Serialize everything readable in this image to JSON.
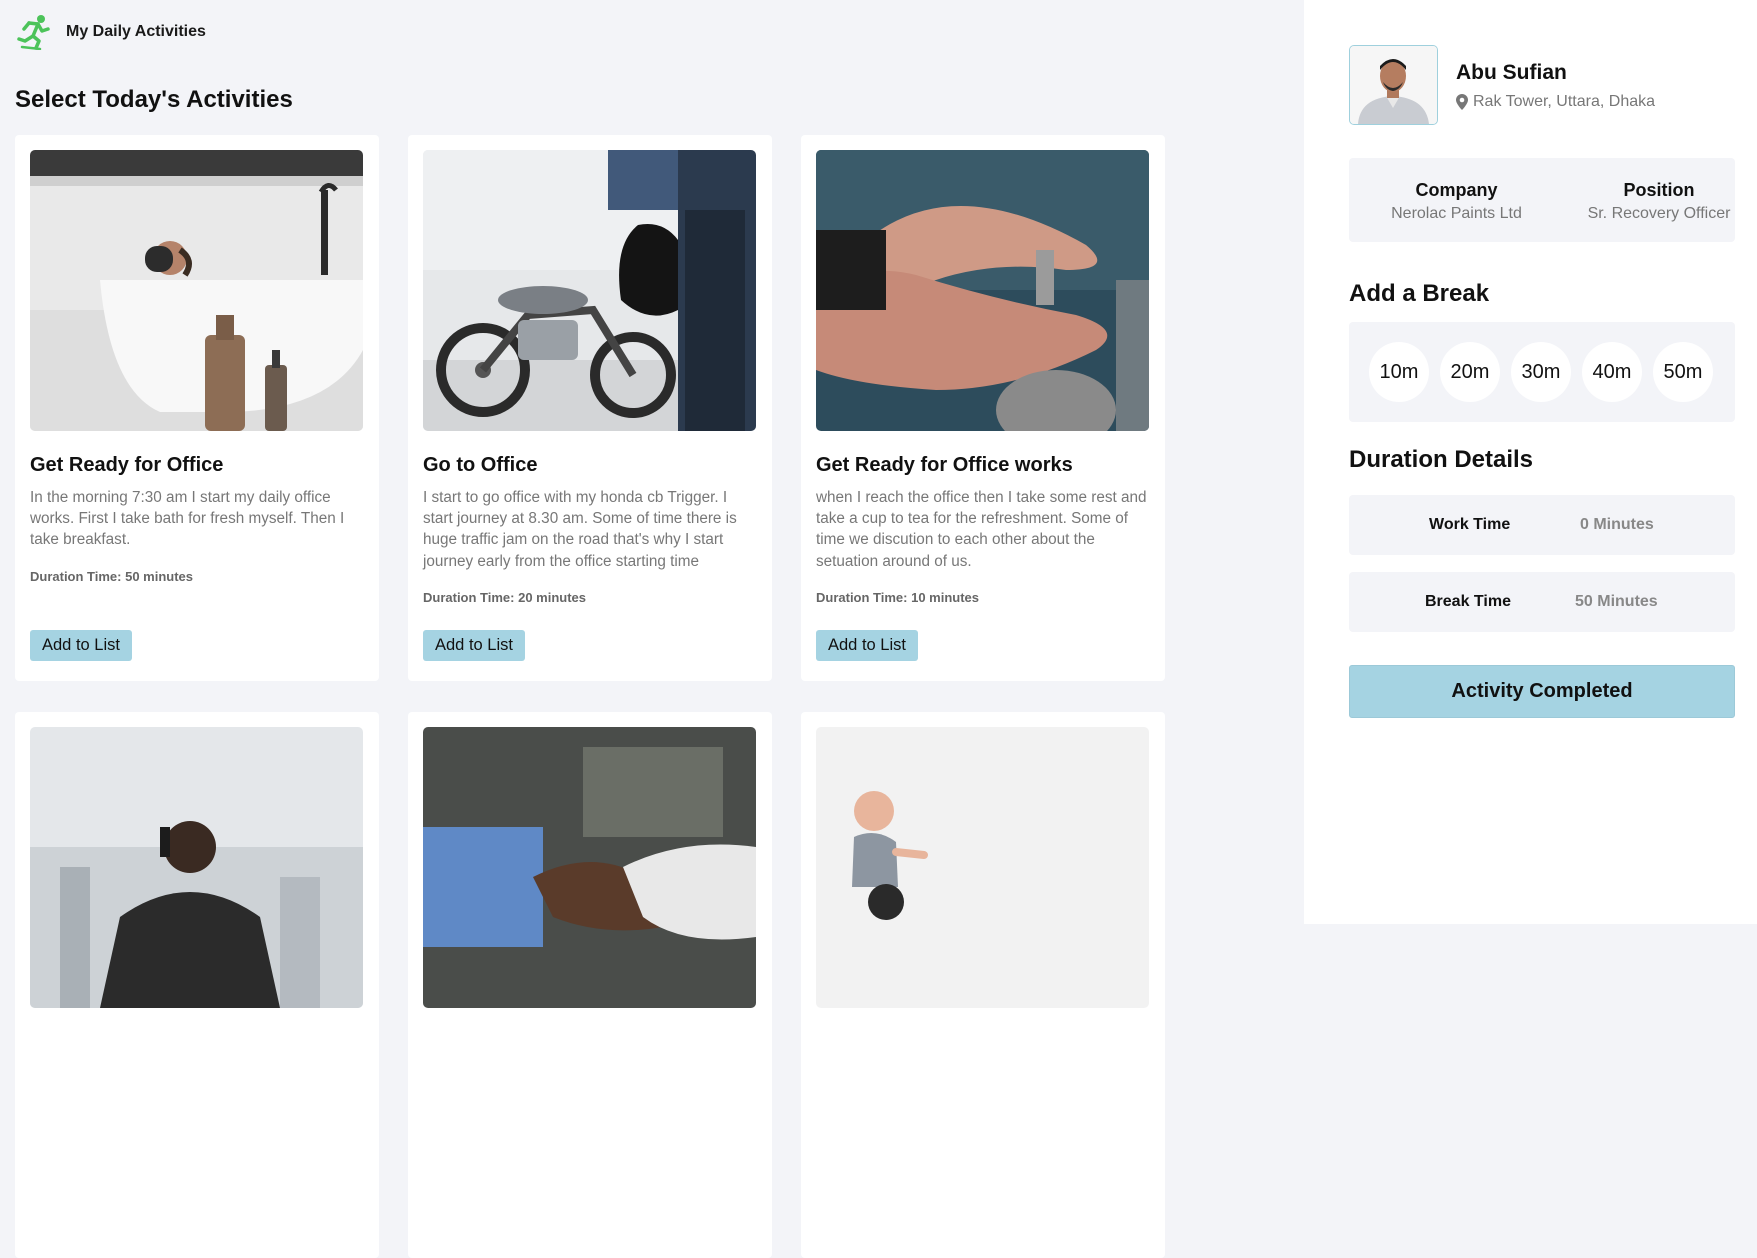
{
  "app": {
    "title": "My Daily Activities",
    "logo_icon": "runner-icon",
    "accent_color": "#4cc35a"
  },
  "page": {
    "heading": "Select Today's Activities"
  },
  "activities": [
    {
      "title": "Get Ready for Office",
      "description": "In the morning 7:30 am I start my daily office works. First I take bath for fresh myself. Then I take breakfast.",
      "duration": "Duration Time: 50 minutes",
      "button": "Add to List"
    },
    {
      "title": "Go to Office",
      "description": "I start to go office with my honda cb Trigger. I start journey at 8.30 am. Some of time there is huge traffic jam on the road that's why I start journey early from the office starting time",
      "duration": "Duration Time: 20 minutes",
      "button": "Add to List"
    },
    {
      "title": "Get Ready for Office works",
      "description": "when I reach the office then I take some rest and take a cup to tea for the refreshment. Some of time we discution to each other about the setuation around of us.",
      "duration": "Duration Time: 10 minutes",
      "button": "Add to List"
    }
  ],
  "profile": {
    "name": "Abu Sufian",
    "location": "Rak Tower, Uttara, Dhaka",
    "company_label": "Company",
    "company": "Nerolac Paints Ltd",
    "position_label": "Position",
    "position": "Sr. Recovery Officer"
  },
  "break": {
    "heading": "Add a Break",
    "options": [
      "10m",
      "20m",
      "30m",
      "40m",
      "50m"
    ]
  },
  "duration_details": {
    "heading": "Duration Details",
    "work_label": "Work Time",
    "work_value": "0 Minutes",
    "break_label": "Break Time",
    "break_value": "50 Minutes"
  },
  "complete_button": "Activity Completed"
}
